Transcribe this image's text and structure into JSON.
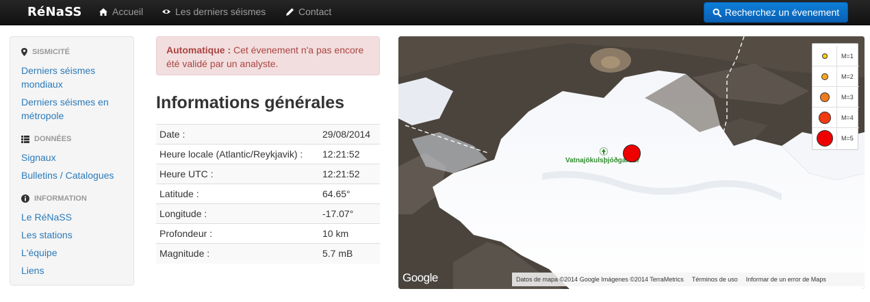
{
  "navbar": {
    "brand": "RéNaSS",
    "items": [
      {
        "label": "Accueil",
        "icon": "home-icon"
      },
      {
        "label": "Les derniers séismes",
        "icon": "eye-icon"
      },
      {
        "label": "Contact",
        "icon": "pencil-icon"
      }
    ],
    "search_button": "Recherchez un évenement"
  },
  "sidebar": {
    "sections": [
      {
        "title": "SISMICITÉ",
        "icon": "map-marker-icon",
        "links": [
          "Derniers séismes mondiaux",
          "Derniers séismes en métropole"
        ]
      },
      {
        "title": "DONNÉES",
        "icon": "list-icon",
        "links": [
          "Signaux",
          "Bulletins / Catalogues"
        ]
      },
      {
        "title": "INFORMATION",
        "icon": "info-icon",
        "links": [
          "Le RéNaSS",
          "Les stations",
          "L'équipe",
          "Liens"
        ]
      }
    ]
  },
  "alert": {
    "bold": "Automatique :",
    "text": " Cet évenement n'a pas encore été validé par un analyste."
  },
  "info": {
    "title": "Informations générales",
    "rows": [
      {
        "label": "Date :",
        "value": "29/08/2014"
      },
      {
        "label": "Heure locale (Atlantic/Reykjavik) :",
        "value": "12:21:52"
      },
      {
        "label": "Heure UTC :",
        "value": "12:21:52"
      },
      {
        "label": "Latitude :",
        "value": "64.65°"
      },
      {
        "label": "Longitude :",
        "value": "-17.07°"
      },
      {
        "label": "Profondeur :",
        "value": "10 km"
      },
      {
        "label": "Magnitude :",
        "value": "5.7 mB"
      }
    ]
  },
  "map": {
    "place_label": "Vatnajökulsþjóðgarður",
    "legend": [
      {
        "label": "M=1",
        "color": "#f5d20a"
      },
      {
        "label": "M=2",
        "color": "#f5a623"
      },
      {
        "label": "M=3",
        "color": "#f07a1a"
      },
      {
        "label": "M=4",
        "color": "#f03a10"
      },
      {
        "label": "M=5",
        "color": "#ee0000"
      }
    ],
    "quake_color": "#ee0000",
    "google_logo": "Google",
    "footer": [
      "Datos de mapa ©2014 Google Imágenes ©2014 TerraMetrics",
      "Términos de uso",
      "Informar de un error de Maps"
    ]
  }
}
